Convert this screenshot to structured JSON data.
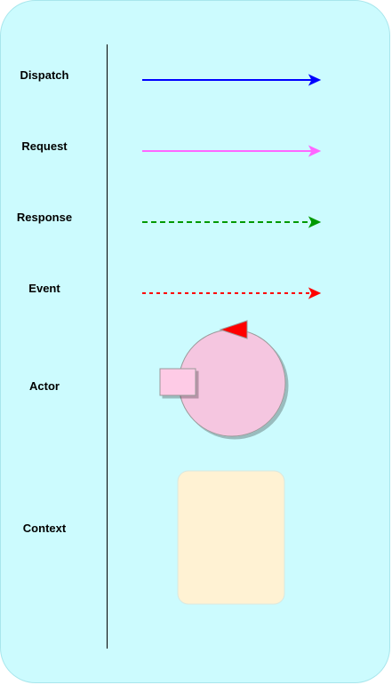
{
  "legend": {
    "items": [
      {
        "key": "dispatch",
        "label": "Dispatch"
      },
      {
        "key": "request",
        "label": "Request"
      },
      {
        "key": "response",
        "label": "Response"
      },
      {
        "key": "event",
        "label": "Event"
      },
      {
        "key": "actor",
        "label": "Actor"
      },
      {
        "key": "context",
        "label": "Context"
      }
    ]
  },
  "colors": {
    "background": "#ccfbfe",
    "dispatch_arrow": "#0000ff",
    "request_arrow": "#ff66ff",
    "response_arrow": "#009900",
    "event_arrow": "#ff0000",
    "actor_fill": "#f5c6e0",
    "actor_port_fill": "#fecbe6",
    "actor_marker": "#ff0000",
    "context_fill": "#fff2d3"
  },
  "styles": {
    "dispatch": "solid",
    "request": "solid",
    "response": "dashed",
    "event": "dashed"
  }
}
